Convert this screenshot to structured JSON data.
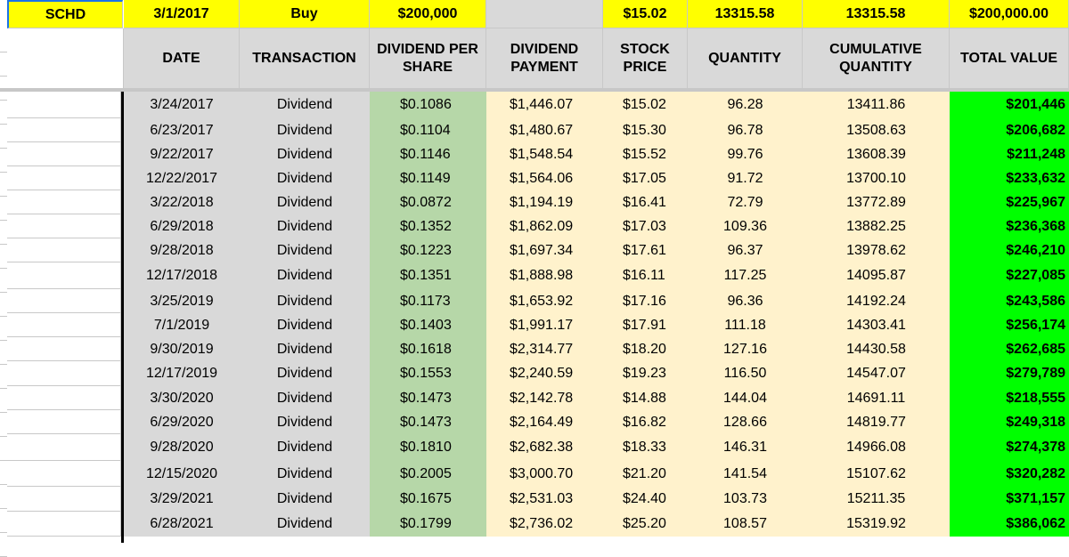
{
  "summary": {
    "ticker": "SCHD",
    "date": "3/1/2017",
    "transaction": "Buy",
    "investment": "$200,000",
    "blank": "",
    "price": "$15.02",
    "quantity": "13315.58",
    "cumulative": "13315.58",
    "total": "$200,000.00"
  },
  "headers": {
    "date": "DATE",
    "transaction": "TRANSACTION",
    "dps": "DIVIDEND PER SHARE",
    "payment": "DIVIDEND PAYMENT",
    "price": "STOCK PRICE",
    "quantity": "QUANTITY",
    "cumulative": "CUMULATIVE QUANTITY",
    "total": "TOTAL VALUE"
  },
  "rows": [
    {
      "date": "3/24/2017",
      "transaction": "Dividend",
      "dps": "$0.1086",
      "payment": "$1,446.07",
      "price": "$15.02",
      "quantity": "96.28",
      "cumulative": "13411.86",
      "total": "$201,446"
    },
    {
      "date": "6/23/2017",
      "transaction": "Dividend",
      "dps": "$0.1104",
      "payment": "$1,480.67",
      "price": "$15.30",
      "quantity": "96.78",
      "cumulative": "13508.63",
      "total": "$206,682"
    },
    {
      "date": "9/22/2017",
      "transaction": "Dividend",
      "dps": "$0.1146",
      "payment": "$1,548.54",
      "price": "$15.52",
      "quantity": "99.76",
      "cumulative": "13608.39",
      "total": "$211,248"
    },
    {
      "date": "12/22/2017",
      "transaction": "Dividend",
      "dps": "$0.1149",
      "payment": "$1,564.06",
      "price": "$17.05",
      "quantity": "91.72",
      "cumulative": "13700.10",
      "total": "$233,632"
    },
    {
      "date": "3/22/2018",
      "transaction": "Dividend",
      "dps": "$0.0872",
      "payment": "$1,194.19",
      "price": "$16.41",
      "quantity": "72.79",
      "cumulative": "13772.89",
      "total": "$225,967"
    },
    {
      "date": "6/29/2018",
      "transaction": "Dividend",
      "dps": "$0.1352",
      "payment": "$1,862.09",
      "price": "$17.03",
      "quantity": "109.36",
      "cumulative": "13882.25",
      "total": "$236,368"
    },
    {
      "date": "9/28/2018",
      "transaction": "Dividend",
      "dps": "$0.1223",
      "payment": "$1,697.34",
      "price": "$17.61",
      "quantity": "96.37",
      "cumulative": "13978.62",
      "total": "$246,210"
    },
    {
      "date": "12/17/2018",
      "transaction": "Dividend",
      "dps": "$0.1351",
      "payment": "$1,888.98",
      "price": "$16.11",
      "quantity": "117.25",
      "cumulative": "14095.87",
      "total": "$227,085"
    },
    {
      "date": "3/25/2019",
      "transaction": "Dividend",
      "dps": "$0.1173",
      "payment": "$1,653.92",
      "price": "$17.16",
      "quantity": "96.36",
      "cumulative": "14192.24",
      "total": "$243,586"
    },
    {
      "date": "7/1/2019",
      "transaction": "Dividend",
      "dps": "$0.1403",
      "payment": "$1,991.17",
      "price": "$17.91",
      "quantity": "111.18",
      "cumulative": "14303.41",
      "total": "$256,174"
    },
    {
      "date": "9/30/2019",
      "transaction": "Dividend",
      "dps": "$0.1618",
      "payment": "$2,314.77",
      "price": "$18.20",
      "quantity": "127.16",
      "cumulative": "14430.58",
      "total": "$262,685"
    },
    {
      "date": "12/17/2019",
      "transaction": "Dividend",
      "dps": "$0.1553",
      "payment": "$2,240.59",
      "price": "$19.23",
      "quantity": "116.50",
      "cumulative": "14547.07",
      "total": "$279,789"
    },
    {
      "date": "3/30/2020",
      "transaction": "Dividend",
      "dps": "$0.1473",
      "payment": "$2,142.78",
      "price": "$14.88",
      "quantity": "144.04",
      "cumulative": "14691.11",
      "total": "$218,555"
    },
    {
      "date": "6/29/2020",
      "transaction": "Dividend",
      "dps": "$0.1473",
      "payment": "$2,164.49",
      "price": "$16.82",
      "quantity": "128.66",
      "cumulative": "14819.77",
      "total": "$249,318"
    },
    {
      "date": "9/28/2020",
      "transaction": "Dividend",
      "dps": "$0.1810",
      "payment": "$2,682.38",
      "price": "$18.33",
      "quantity": "146.31",
      "cumulative": "14966.08",
      "total": "$274,378"
    },
    {
      "date": "12/15/2020",
      "transaction": "Dividend",
      "dps": "$0.2005",
      "payment": "$3,000.70",
      "price": "$21.20",
      "quantity": "141.54",
      "cumulative": "15107.62",
      "total": "$320,282"
    },
    {
      "date": "3/29/2021",
      "transaction": "Dividend",
      "dps": "$0.1675",
      "payment": "$2,531.03",
      "price": "$24.40",
      "quantity": "103.73",
      "cumulative": "15211.35",
      "total": "$371,157"
    },
    {
      "date": "6/28/2021",
      "transaction": "Dividend",
      "dps": "$0.1799",
      "payment": "$2,736.02",
      "price": "$25.20",
      "quantity": "108.57",
      "cumulative": "15319.92",
      "total": "$386,062"
    }
  ],
  "colors": {
    "yellow": "#ffff00",
    "header_gray": "#d9d9d9",
    "dps_green": "#b6d7a8",
    "cream": "#fff2cc",
    "total_green": "#00ff00",
    "selection_blue": "#1a73e8"
  }
}
